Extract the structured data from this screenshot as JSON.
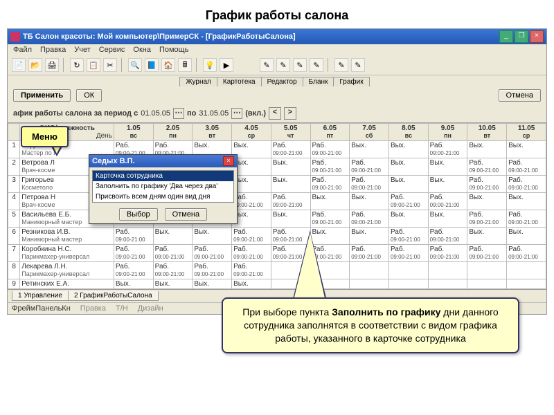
{
  "slide_title": "График работы салона",
  "window_title": "ТБ Салон красоты: Мой компьютер\\ПримерСК - [ГрафикРаботыСалона]",
  "menubar": [
    "Файл",
    "Правка",
    "Учет",
    "Сервис",
    "Окна",
    "Помощь"
  ],
  "tabs": [
    "Журнал",
    "Картотека",
    "Редактор",
    "Бланк",
    "График"
  ],
  "buttons": {
    "apply": "Применить",
    "ok": "ОК",
    "cancel": "Отмена"
  },
  "period": {
    "prefix": "афик работы салона за период с",
    "from": "01.05.05",
    "to_label": "по",
    "to": "31.05.05",
    "incl": "(вкл.)"
  },
  "headers": {
    "name": "ФИО/должность",
    "day_label": "День"
  },
  "days": [
    {
      "d": "1.05",
      "w": "вс"
    },
    {
      "d": "2.05",
      "w": "пн"
    },
    {
      "d": "3.05",
      "w": "вт"
    },
    {
      "d": "4.05",
      "w": "ср"
    },
    {
      "d": "5.05",
      "w": "чт"
    },
    {
      "d": "6.05",
      "w": "пт"
    },
    {
      "d": "7.05",
      "w": "сб"
    },
    {
      "d": "8.05",
      "w": "вс"
    },
    {
      "d": "9.05",
      "w": "пн"
    },
    {
      "d": "10.05",
      "w": "вт"
    },
    {
      "d": "11.05",
      "w": "ср"
    }
  ],
  "rows": [
    {
      "n": "1",
      "name": "Седых В.П.",
      "sub": "Мастер по н",
      "cells": [
        "",
        "R",
        "R",
        "V",
        "V",
        "R",
        "R",
        "V",
        "V",
        "R",
        "V",
        "V"
      ]
    },
    {
      "n": "2",
      "name": "Ветрова Л",
      "sub": "Врач-косме",
      "cells": [
        "",
        "",
        "",
        "",
        "V",
        "V",
        "R",
        "R",
        "V",
        "V",
        "R",
        "R"
      ]
    },
    {
      "n": "3",
      "name": "Григорьев",
      "sub": "Косметоло",
      "cells": [
        "",
        "",
        "",
        "",
        "V",
        "V",
        "R",
        "R",
        "V",
        "V",
        "R",
        "R"
      ]
    },
    {
      "n": "4",
      "name": "Петрова Н",
      "sub": "Врач-косме",
      "cells": [
        "",
        "",
        "",
        "",
        "R",
        "R",
        "V",
        "V",
        "R",
        "R",
        "V",
        "V"
      ]
    },
    {
      "n": "5",
      "name": "Васильева Е.Б.",
      "sub": "Маникюрный мастер",
      "cells": [
        "",
        "V",
        "R",
        "R",
        "V",
        "V",
        "R",
        "R",
        "V",
        "V",
        "R",
        "R"
      ]
    },
    {
      "n": "6",
      "name": "Резникова И.В.",
      "sub": "Маникюрный мастер",
      "cells": [
        "",
        "R",
        "V",
        "V",
        "R",
        "R",
        "V",
        "V",
        "R",
        "R",
        "V",
        "V"
      ]
    },
    {
      "n": "7",
      "name": "Коробкина Н.С.",
      "sub": "Парикмахер-универсал",
      "cells": [
        "",
        "R",
        "R",
        "R",
        "R",
        "R",
        "R",
        "R",
        "R",
        "R",
        "R",
        "R"
      ]
    },
    {
      "n": "8",
      "name": "Лекарева Л.Н.",
      "sub": "Парикмахер-универсал",
      "cells": [
        "",
        "R",
        "R",
        "R",
        "R",
        "",
        "",
        "",
        "",
        "",
        "",
        ""
      ]
    },
    {
      "n": "9",
      "name": "Ретинских Е.А.",
      "sub": "",
      "cells": [
        "",
        "V",
        "V",
        "V",
        "V",
        "",
        "",
        "",
        "",
        "",
        "",
        ""
      ]
    }
  ],
  "cell_labels": {
    "R": "Раб.",
    "V": "Вых.",
    "time": "09:00-21:00"
  },
  "bottom_tabs": [
    "1 Управление",
    "2 ГрафикРаботыСалона"
  ],
  "status": [
    "ФреймПанельКн",
    "Правка",
    "Т/Н",
    "Дизайн"
  ],
  "menu_label": "Меню",
  "popup": {
    "title": "Седых В.П.",
    "items": [
      "Карточка сотрудника",
      "Заполнить по графику 'Два через два'",
      "Присвоить всем дням один вид дня"
    ],
    "select": "Выбор",
    "cancel": "Отмена"
  },
  "callout_parts": {
    "p1": "При выборе пункта ",
    "b1": "Заполнить по графику",
    "p2": " дни данного сотрудника заполнятся в соответствии с видом графика работы, указанного в карточке сотрудника"
  }
}
